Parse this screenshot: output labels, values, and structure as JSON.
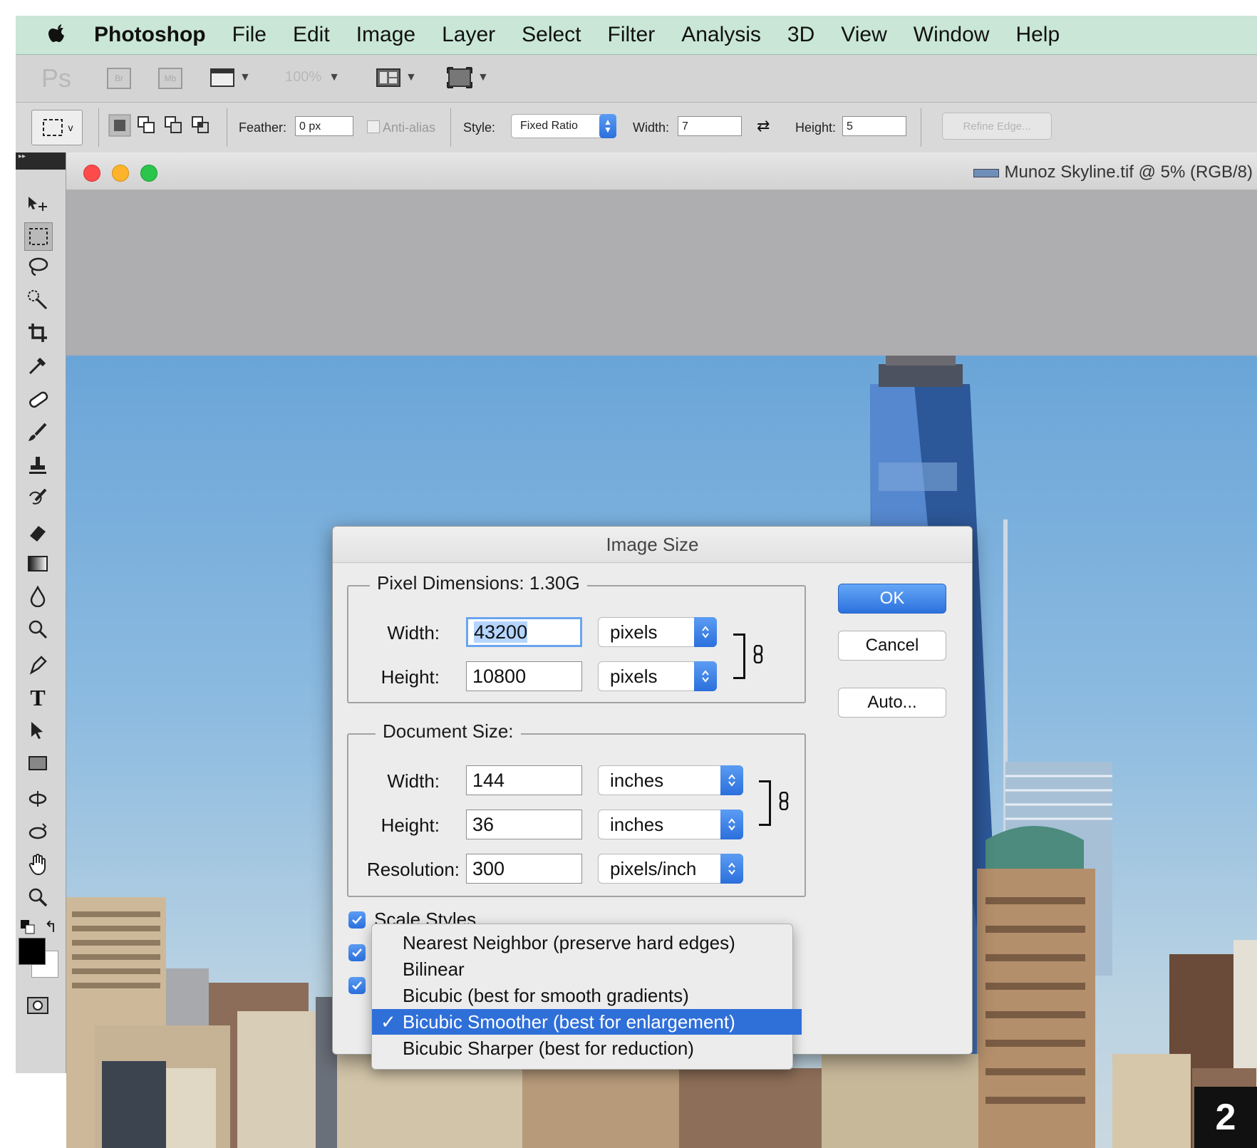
{
  "menubar": {
    "app_name": "Photoshop",
    "items": [
      "File",
      "Edit",
      "Image",
      "Layer",
      "Select",
      "Filter",
      "Analysis",
      "3D",
      "View",
      "Window",
      "Help"
    ]
  },
  "appbar": {
    "ps_logo": "Ps",
    "br_label": "Br",
    "mb_label": "Mb",
    "zoom": "100%"
  },
  "options": {
    "feather_label": "Feather:",
    "feather_value": "0 px",
    "antialias_label": "Anti-alias",
    "style_label": "Style:",
    "style_value": "Fixed Ratio",
    "width_label": "Width:",
    "width_value": "7",
    "height_label": "Height:",
    "height_value": "5",
    "refine_edge": "Refine Edge..."
  },
  "document": {
    "title": "Munoz Skyline.tif @ 5% (RGB/8)"
  },
  "dialog": {
    "title": "Image Size",
    "pixel_dimensions": {
      "legend": "Pixel Dimensions:  1.30G",
      "width_label": "Width:",
      "width_value": "43200",
      "width_unit": "pixels",
      "height_label": "Height:",
      "height_value": "10800",
      "height_unit": "pixels"
    },
    "document_size": {
      "legend": "Document Size:",
      "width_label": "Width:",
      "width_value": "144",
      "width_unit": "inches",
      "height_label": "Height:",
      "height_value": "36",
      "height_unit": "inches",
      "resolution_label": "Resolution:",
      "resolution_value": "300",
      "resolution_unit": "pixels/inch"
    },
    "scale_styles": "Scale Styles",
    "buttons": {
      "ok": "OK",
      "cancel": "Cancel",
      "auto": "Auto..."
    }
  },
  "resample_menu": {
    "items": [
      "Nearest Neighbor (preserve hard edges)",
      "Bilinear",
      "Bicubic (best for smooth gradients)",
      "Bicubic Smoother (best for enlargement)",
      "Bicubic Sharper (best for reduction)"
    ],
    "selected_mark": "✓",
    "selected_index": 3
  },
  "step_badge": "2",
  "colors": {
    "menubar_bg": "#c9e6d6",
    "accent_blue": "#2f6fd8",
    "sky_top": "#6aa5d8"
  }
}
